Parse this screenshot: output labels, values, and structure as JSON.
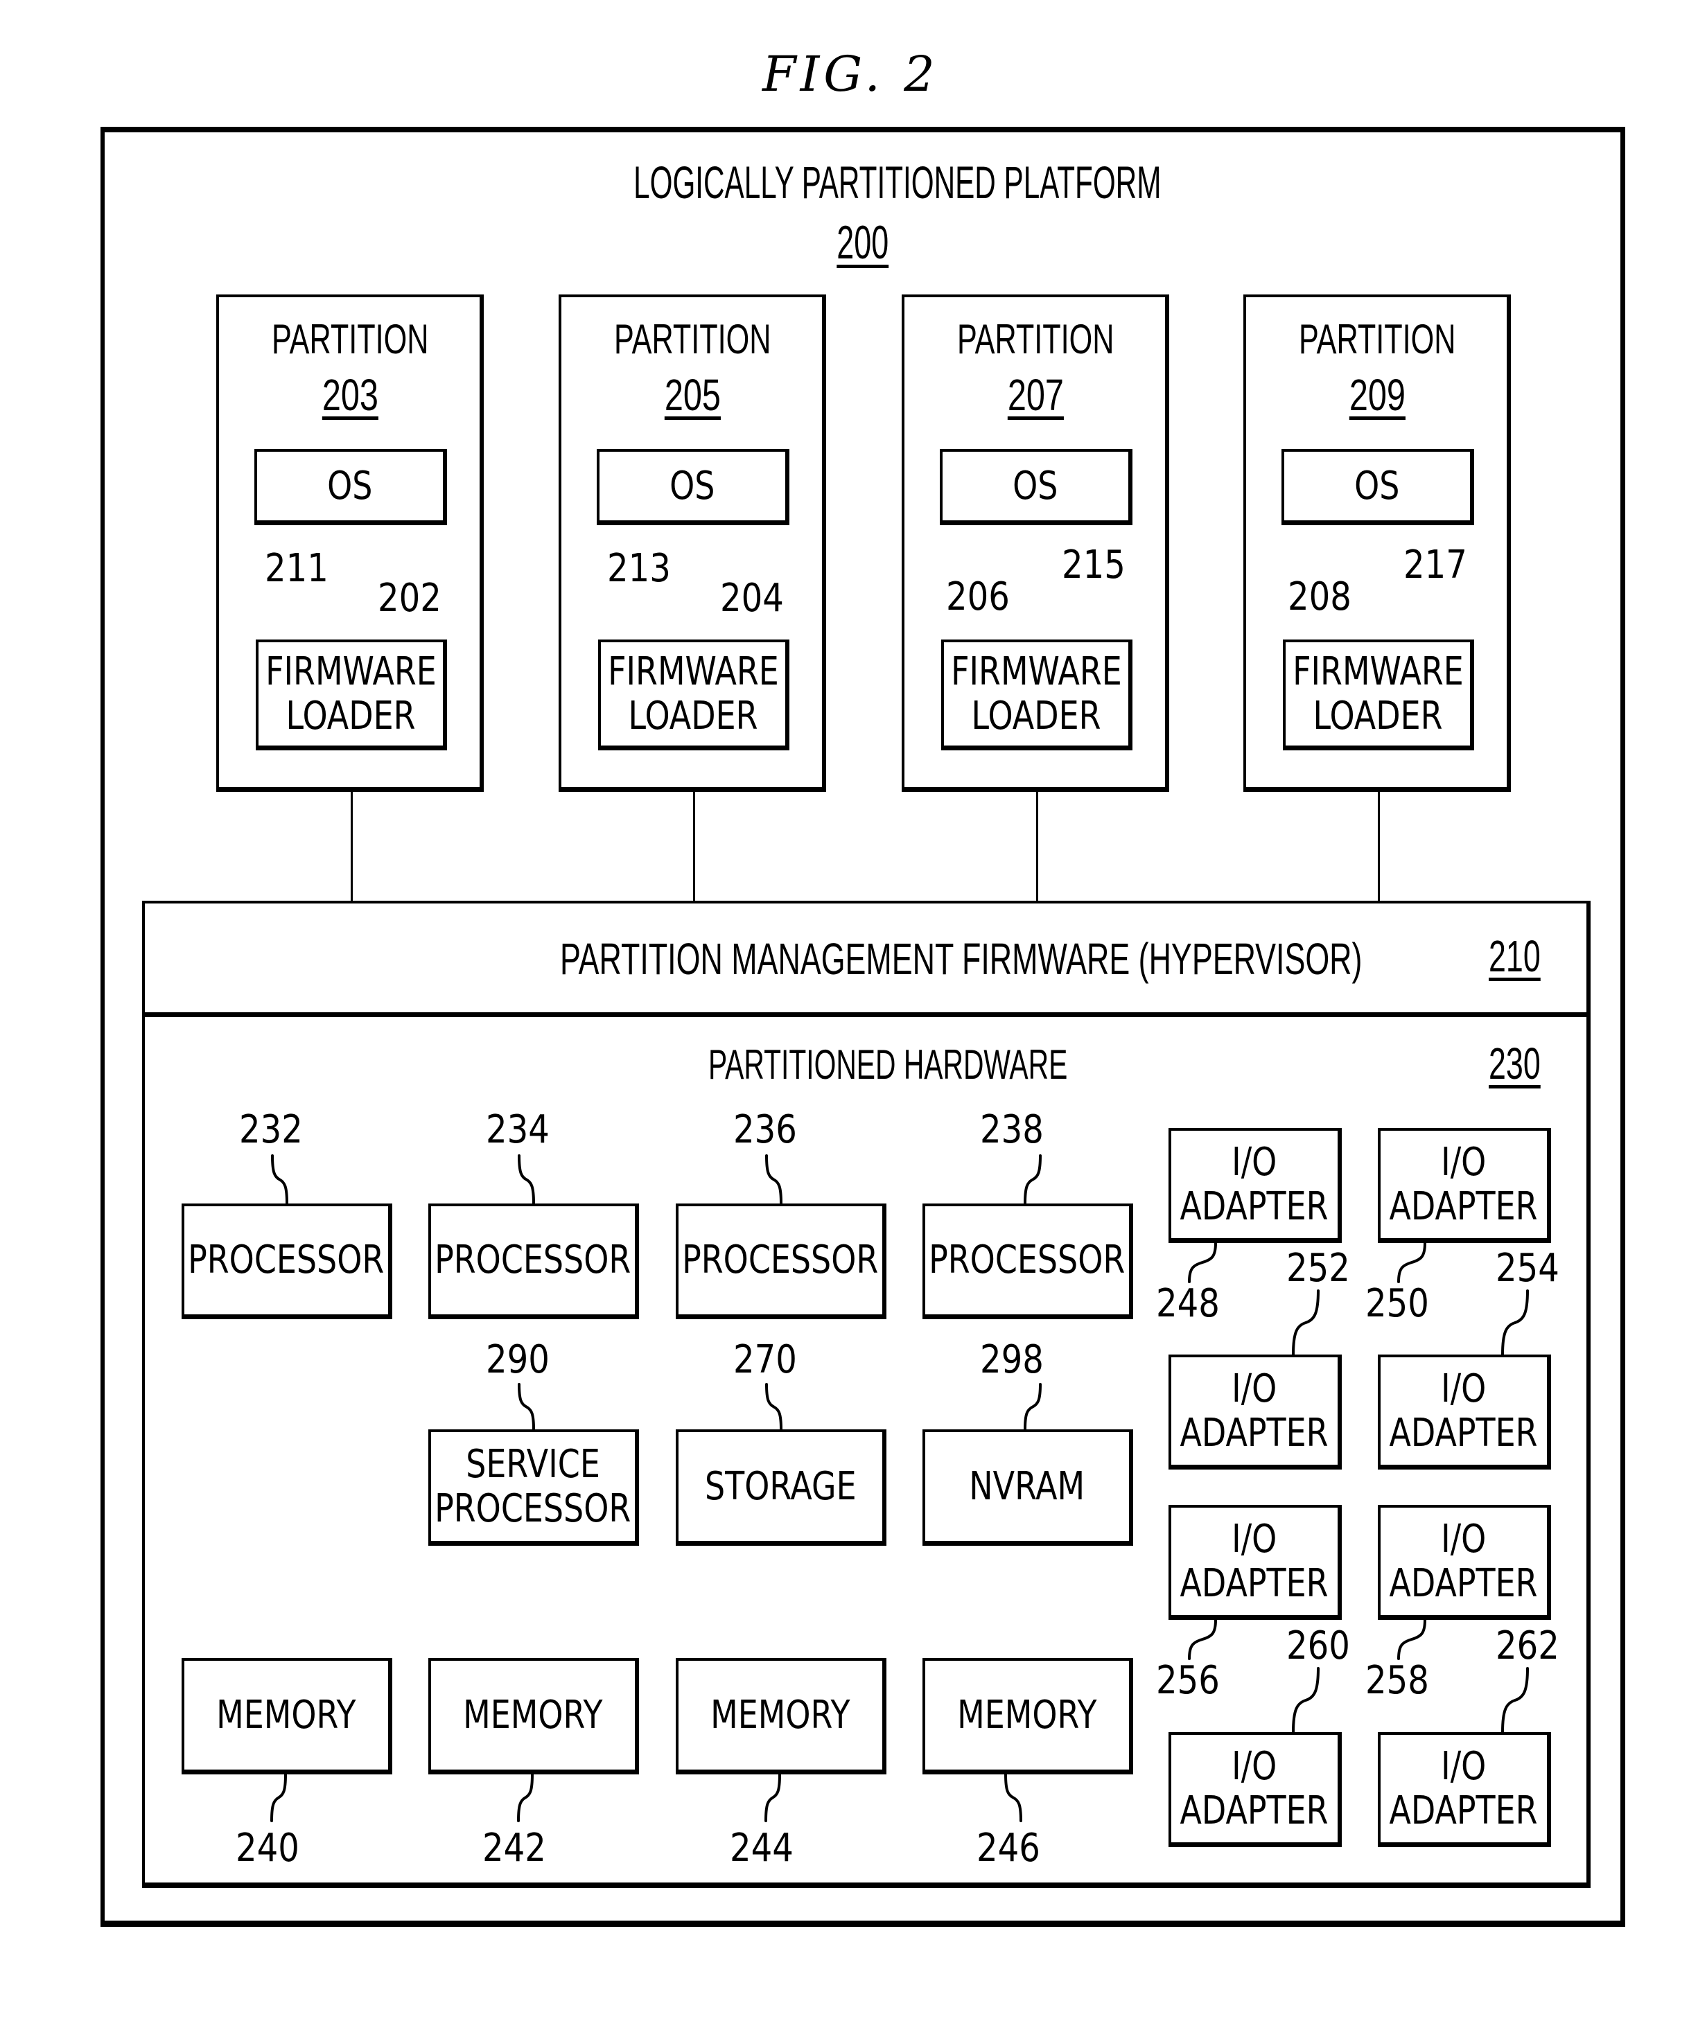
{
  "figure": {
    "title": "FIG.  2"
  },
  "platform": {
    "title": "LOGICALLY PARTITIONED PLATFORM",
    "ref": "200"
  },
  "partitions": [
    {
      "title": "PARTITION",
      "ref": "203",
      "os_label": "OS",
      "os_ref": "202",
      "loader_line1": "FIRMWARE",
      "loader_line2": "LOADER",
      "loader_ref": "211"
    },
    {
      "title": "PARTITION",
      "ref": "205",
      "os_label": "OS",
      "os_ref": "204",
      "loader_line1": "FIRMWARE",
      "loader_line2": "LOADER",
      "loader_ref": "213"
    },
    {
      "title": "PARTITION",
      "ref": "207",
      "os_label": "OS",
      "os_ref": "206",
      "loader_line1": "FIRMWARE",
      "loader_line2": "LOADER",
      "loader_ref": "215"
    },
    {
      "title": "PARTITION",
      "ref": "209",
      "os_label": "OS",
      "os_ref": "208",
      "loader_line1": "FIRMWARE",
      "loader_line2": "LOADER",
      "loader_ref": "217"
    }
  ],
  "hypervisor": {
    "title": "PARTITION MANAGEMENT FIRMWARE (HYPERVISOR)",
    "ref": "210"
  },
  "hardware": {
    "title": "PARTITIONED HARDWARE",
    "ref": "230",
    "processors": [
      {
        "label": "PROCESSOR",
        "ref": "232"
      },
      {
        "label": "PROCESSOR",
        "ref": "234"
      },
      {
        "label": "PROCESSOR",
        "ref": "236"
      },
      {
        "label": "PROCESSOR",
        "ref": "238"
      }
    ],
    "support": [
      {
        "line1": "SERVICE",
        "line2": "PROCESSOR",
        "ref": "290"
      },
      {
        "line1": "STORAGE",
        "line2": "",
        "ref": "270"
      },
      {
        "line1": "NVRAM",
        "line2": "",
        "ref": "298"
      }
    ],
    "memories": [
      {
        "label": "MEMORY",
        "ref": "240"
      },
      {
        "label": "MEMORY",
        "ref": "242"
      },
      {
        "label": "MEMORY",
        "ref": "244"
      },
      {
        "label": "MEMORY",
        "ref": "246"
      }
    ],
    "io_adapters": [
      {
        "line1": "I/O",
        "line2": "ADAPTER",
        "ref": "248"
      },
      {
        "line1": "I/O",
        "line2": "ADAPTER",
        "ref": "250"
      },
      {
        "line1": "I/O",
        "line2": "ADAPTER",
        "ref": "252"
      },
      {
        "line1": "I/O",
        "line2": "ADAPTER",
        "ref": "254"
      },
      {
        "line1": "I/O",
        "line2": "ADAPTER",
        "ref": "256"
      },
      {
        "line1": "I/O",
        "line2": "ADAPTER",
        "ref": "258"
      },
      {
        "line1": "I/O",
        "line2": "ADAPTER",
        "ref": "260"
      },
      {
        "line1": "I/O",
        "line2": "ADAPTER",
        "ref": "262"
      }
    ]
  }
}
